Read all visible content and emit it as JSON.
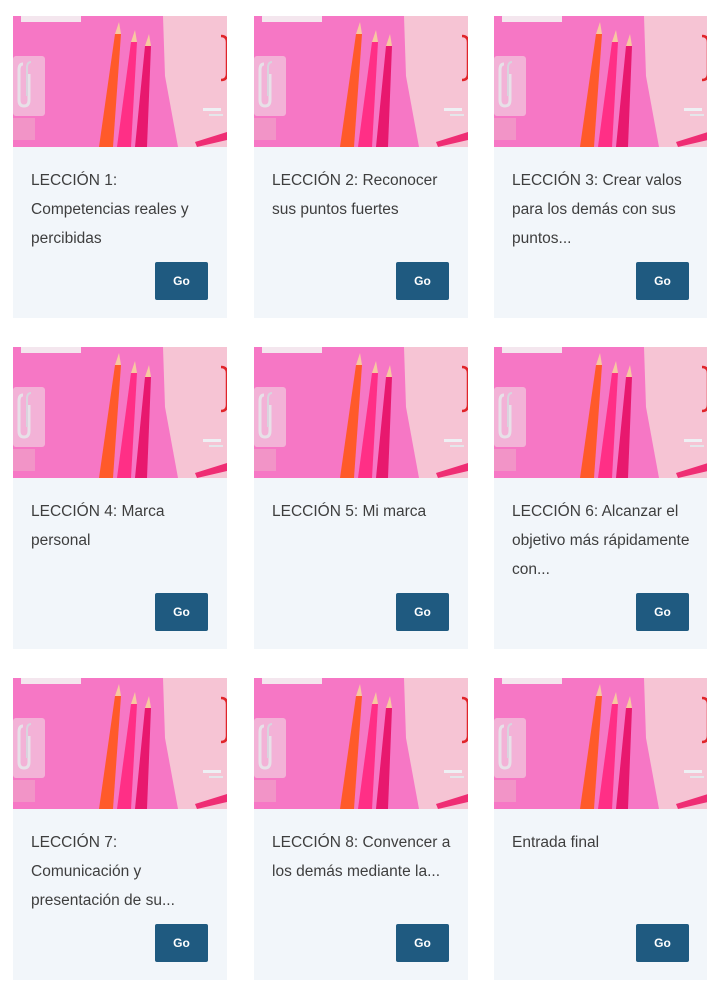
{
  "lessons": [
    {
      "title": "LECCIÓN 1: Competencias reales y percibidas",
      "button": "Go"
    },
    {
      "title": "LECCIÓN 2: Reconocer sus puntos fuertes",
      "button": "Go"
    },
    {
      "title": "LECCIÓN 3: Crear valos para los demás con sus puntos...",
      "button": "Go"
    },
    {
      "title": "LECCIÓN 4: Marca personal",
      "button": "Go"
    },
    {
      "title": "LECCIÓN 5: Mi marca",
      "button": "Go"
    },
    {
      "title": "LECCIÓN 6: Alcanzar el objetivo más rápidamente con...",
      "button": "Go"
    },
    {
      "title": "LECCIÓN 7: Comunicación y presentación de su...",
      "button": "Go"
    },
    {
      "title": "LECCIÓN 8: Convencer a los demás mediante la...",
      "button": "Go"
    },
    {
      "title": "Entrada final",
      "button": "Go"
    }
  ],
  "colors": {
    "card_background": "#f2f6fa",
    "button_background": "#1f5a80",
    "title_text": "#3e3e3e",
    "thumb_pink": "#f46fc0"
  },
  "thumbnail_icon": "pink-pencils-desk-photo"
}
